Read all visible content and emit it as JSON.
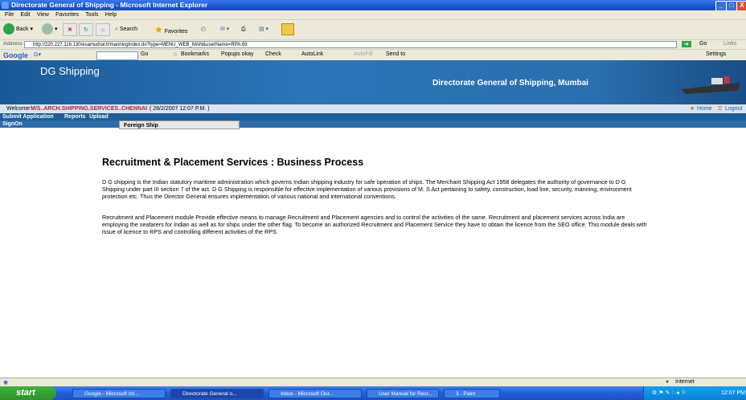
{
  "window": {
    "title": "Directorate General of Shipping - Microsoft Internet Explorer",
    "minimize": "_",
    "maximize": "□",
    "close": "X"
  },
  "menu": [
    "File",
    "Edit",
    "View",
    "Favorites",
    "Tools",
    "Help"
  ],
  "toolbar": {
    "back": "Back",
    "search": "Search",
    "favorites": "Favorites"
  },
  "address": {
    "label": "Address",
    "url": "http://220.227.116.130/esamudraUI/manningIndex.do?type=MENU_WEB_MAN&userName=RPA.69",
    "go": "Go",
    "links": "Links"
  },
  "googlebar": {
    "logo": "Google",
    "go": "Go",
    "bookmarks": "Bookmarks",
    "popups": "Popups okay",
    "check": "Check",
    "autolink": "AutoLink",
    "autofill": "AutoFill",
    "sendto": "Send to",
    "settings": "Settings"
  },
  "banner": {
    "brand": "DG Shipping",
    "org": "Directorate General of Shipping, Mumbai"
  },
  "welcome": {
    "prefix": "Welcome",
    "user": "M/S..ARCH.SHIPPING.SERVICES..CHENNAI",
    "date": "( 28/2/2007 12:07 P.M. )",
    "home": "Home",
    "logout": "Logout"
  },
  "nav": {
    "items": [
      "Submit Application",
      "Reports",
      "Upload"
    ],
    "signon": "SignOn",
    "dropdown": "Foreign Ship"
  },
  "content": {
    "heading": "Recruitment & Placement Services : Business Process",
    "para1": "D G shipping is the Indian statutory maritime administration which governs Indian shipping industry for safe operation of ships. The Merchant Shipping Act 1958 delegates the authority of governance to D G Shipping under part III section 7 of the act. D G Shipping is responsible for effective implementation of various provisions of M. S Act pertaining to safety, construction, load line, security, manning, environment protection etc. Thus the Director General ensures implementation of various national and international conventions.",
    "para2": "Recruitment and Placement module Provide effective means to manage Recruitment and Placement agencies and to control the activities of the same. Recruitment and placement services across India are employing the seafarers for Indian as well as for ships under the other flag. To become an authorized Recruitment and Placement Service they have to obtain the licence from the SEO office. This module deals with issue of licence to RPS and controlling different activities of the RPS."
  },
  "status": {
    "zone": "Internet"
  },
  "taskbar": {
    "start": "start",
    "tasks": [
      "Google - Microsoft Int...",
      "Directorate General o...",
      "Inbox - Microsoft Out...",
      "User Manual for Recr...",
      "3 - Paint"
    ],
    "clock": "12:07 PM"
  }
}
